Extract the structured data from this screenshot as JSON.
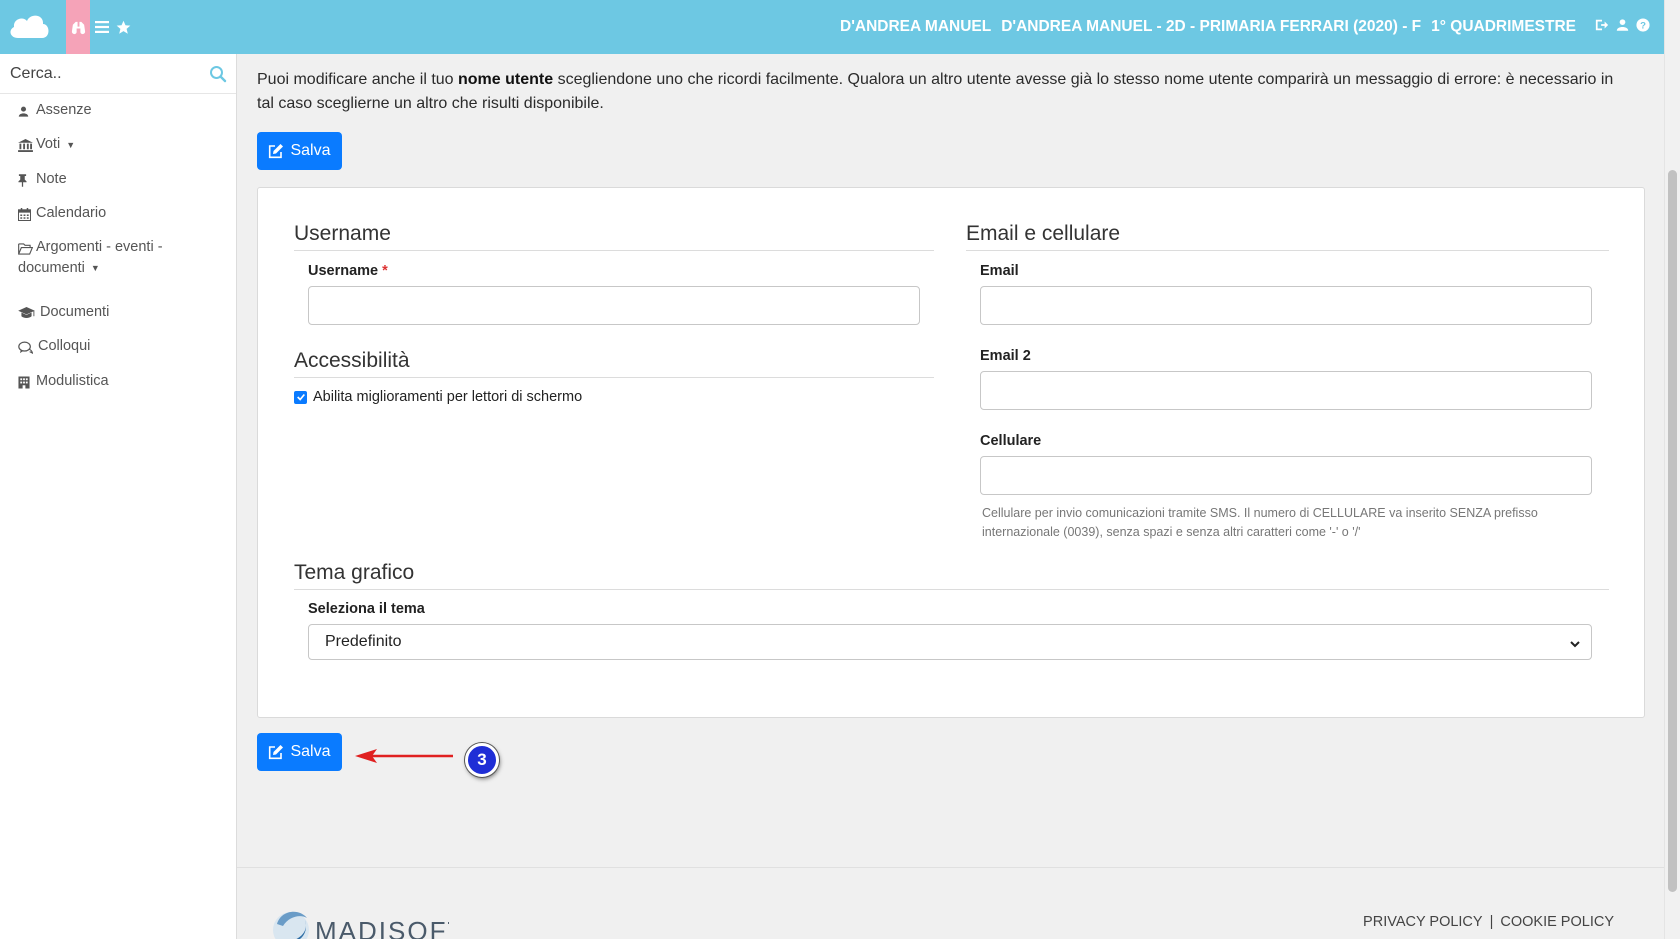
{
  "topbar": {
    "user_name": "D'ANDREA MANUEL",
    "student_class": "D'ANDREA MANUEL - 2D - PRIMARIA FERRARI (2020) - F",
    "period": "1° QUADRIMESTRE",
    "colors": {
      "bar": "#6dc8e3",
      "active_tab": "#f5a3b8"
    }
  },
  "sidebar": {
    "search_placeholder": "Cerca..",
    "items": [
      {
        "label": "Assenze",
        "icon": "user-icon"
      },
      {
        "label": "Voti",
        "icon": "bank-icon",
        "has_dropdown": true
      },
      {
        "label": "Note",
        "icon": "pin-icon"
      },
      {
        "label": "Calendario",
        "icon": "calendar-icon"
      },
      {
        "label_line1": "Argomenti - eventi -",
        "label_line2": "documenti",
        "icon": "folder-icon",
        "has_dropdown": true
      },
      {
        "label": "Documenti",
        "icon": "graduation-cap-icon"
      },
      {
        "label": "Colloqui",
        "icon": "chat-icon"
      },
      {
        "label": "Modulistica",
        "icon": "building-icon"
      }
    ]
  },
  "main": {
    "intro_before": "Puoi modificare anche il tuo ",
    "intro_bold": "nome utente",
    "intro_after": " scegliendone uno che ricordi facilmente. Qualora un altro utente avesse già lo stesso nome utente comparirà un messaggio di errore: è necessario in tal caso sceglierne un altro che risulti disponibile.",
    "save_label": "Salva",
    "accent": "#0a7bff"
  },
  "form": {
    "username_section": "Username",
    "username_label": "Username",
    "username_required": "*",
    "username_value": "",
    "accessibility_section": "Accessibilità",
    "screen_reader_label": "Abilita miglioramenti per lettori di schermo",
    "screen_reader_checked": true,
    "contact_section": "Email e cellulare",
    "email_label": "Email",
    "email_value": "",
    "email2_label": "Email 2",
    "email2_value": "",
    "cell_label": "Cellulare",
    "cell_value": "",
    "cell_hint_line1": "Cellulare per invio comunicazioni tramite SMS. Il numero di CELLULARE va inserito SENZA prefisso",
    "cell_hint_line2": "internazionale (0039), senza spazi e senza altri caratteri come '-' o '/'",
    "theme_section": "Tema grafico",
    "theme_label": "Seleziona il tema",
    "theme_value": "Predefinito"
  },
  "annotation": {
    "step": "3",
    "arrow_color": "#e02020",
    "badge_color": "#1f2ed6"
  },
  "footer": {
    "brand": "MADISOFT",
    "privacy": "PRIVACY POLICY",
    "separator": "|",
    "cookie": "COOKIE POLICY"
  }
}
